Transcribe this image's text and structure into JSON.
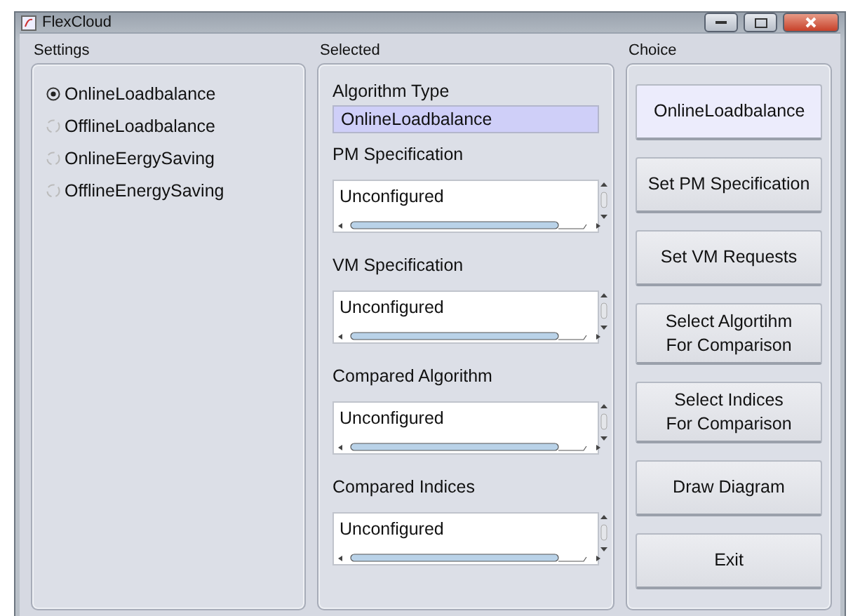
{
  "window": {
    "title": "FlexCloud"
  },
  "settings": {
    "heading": "Settings",
    "options": [
      {
        "label": "OnlineLoadbalance",
        "selected": true
      },
      {
        "label": "OfflineLoadbalance",
        "selected": false
      },
      {
        "label": "OnlineEergySaving",
        "selected": false
      },
      {
        "label": "OfflineEnergySaving",
        "selected": false
      }
    ]
  },
  "selected": {
    "heading": "Selected",
    "algorithm_type": {
      "label": "Algorithm Type",
      "value": "OnlineLoadbalance"
    },
    "lists": [
      {
        "label": "PM Specification",
        "items": [
          "Unconfigured"
        ]
      },
      {
        "label": "VM Specification",
        "items": [
          "Unconfigured"
        ]
      },
      {
        "label": "Compared Algorithm",
        "items": [
          "Unconfigured"
        ]
      },
      {
        "label": "Compared Indices",
        "items": [
          "Unconfigured"
        ]
      }
    ]
  },
  "choice": {
    "heading": "Choice",
    "buttons": [
      {
        "lines": [
          "OnlineLoadbalance"
        ],
        "selected": true
      },
      {
        "lines": [
          "Set PM Specification"
        ],
        "selected": false
      },
      {
        "lines": [
          "Set VM Requests"
        ],
        "selected": false
      },
      {
        "lines": [
          "Select Algortihm",
          "For Comparison"
        ],
        "selected": false
      },
      {
        "lines": [
          "Select Indices",
          "For Comparison"
        ],
        "selected": false
      },
      {
        "lines": [
          "Draw Diagram"
        ],
        "selected": false
      },
      {
        "lines": [
          "Exit"
        ],
        "selected": false
      }
    ]
  }
}
